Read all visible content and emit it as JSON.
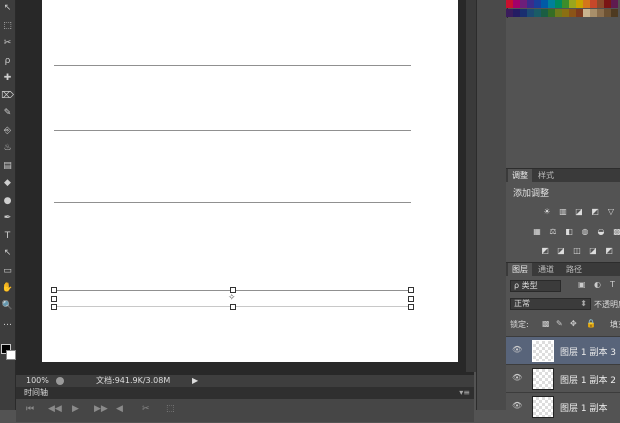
{
  "status_bar": {
    "zoom": "100%",
    "doc_size": "文档:941.9K/3.08M",
    "arrow": "▶"
  },
  "timeline": {
    "tab": "时间轴",
    "menu": "▾≡"
  },
  "adjustments_panel": {
    "tabs": [
      "调整",
      "样式"
    ],
    "add_label": "添加调整",
    "icons_row1": [
      "☀",
      "▥",
      "◪",
      "◩",
      "▽"
    ],
    "icons_row2": [
      "▦",
      "⚖",
      "◧",
      "◍",
      "◒",
      "▩"
    ],
    "icons_row3": [
      "◩",
      "◪",
      "◫",
      "◪",
      "◩"
    ]
  },
  "layers_panel": {
    "tabs": [
      "图层",
      "通道",
      "路径"
    ],
    "filter_label": "ρ 类型",
    "filter_icons": [
      "▣",
      "◐",
      "T"
    ],
    "blend_mode": "正常",
    "opacity_label": "不透明度",
    "lock_label": "锁定:",
    "lock_icons": [
      "▩",
      "✎",
      "✥",
      "🔒"
    ],
    "fill_label": "填充",
    "layers": [
      {
        "name": "图层 1 副本 3",
        "selected": true
      },
      {
        "name": "图层 1 副本 2",
        "selected": false
      },
      {
        "name": "图层 1 副本",
        "selected": false
      }
    ]
  },
  "toolbar": {
    "tools": [
      "↖",
      "⬚",
      "✂",
      "ρ",
      "✚",
      "⌦",
      "✎",
      "⎆",
      "♨",
      "▤",
      "◆",
      "●",
      "✒",
      "T",
      "↖",
      "▭",
      "✋",
      "🔍",
      "…"
    ]
  },
  "timeline_controls": [
    "⏮",
    "◀◀",
    "▶",
    "▶▶",
    "◀",
    "✂",
    "⬚"
  ],
  "colors": {
    "workspace": "#535353",
    "canvas_background": "#282828",
    "document": "#ffffff",
    "selected_layer": "#58647a",
    "swatches": [
      "#c8102e",
      "#a3006b",
      "#6d1f7a",
      "#3b2c8c",
      "#1a3f9b",
      "#005aa6",
      "#00809a",
      "#008a5e",
      "#3c8d2b",
      "#9aa61e",
      "#c9a300",
      "#d4761a",
      "#c7472a",
      "#8b4a2b",
      "#7a1515",
      "#5f1b50",
      "#3a1c5c",
      "#241c63",
      "#1a2f70",
      "#1c4b73",
      "#1a5c66",
      "#1b5e43",
      "#356d25",
      "#6f7a1b",
      "#8a6f12",
      "#8b5417",
      "#7d3a1e",
      "#c9b48f",
      "#a88f6a",
      "#8a6e4c",
      "#6d5233",
      "#4e3a21"
    ]
  }
}
